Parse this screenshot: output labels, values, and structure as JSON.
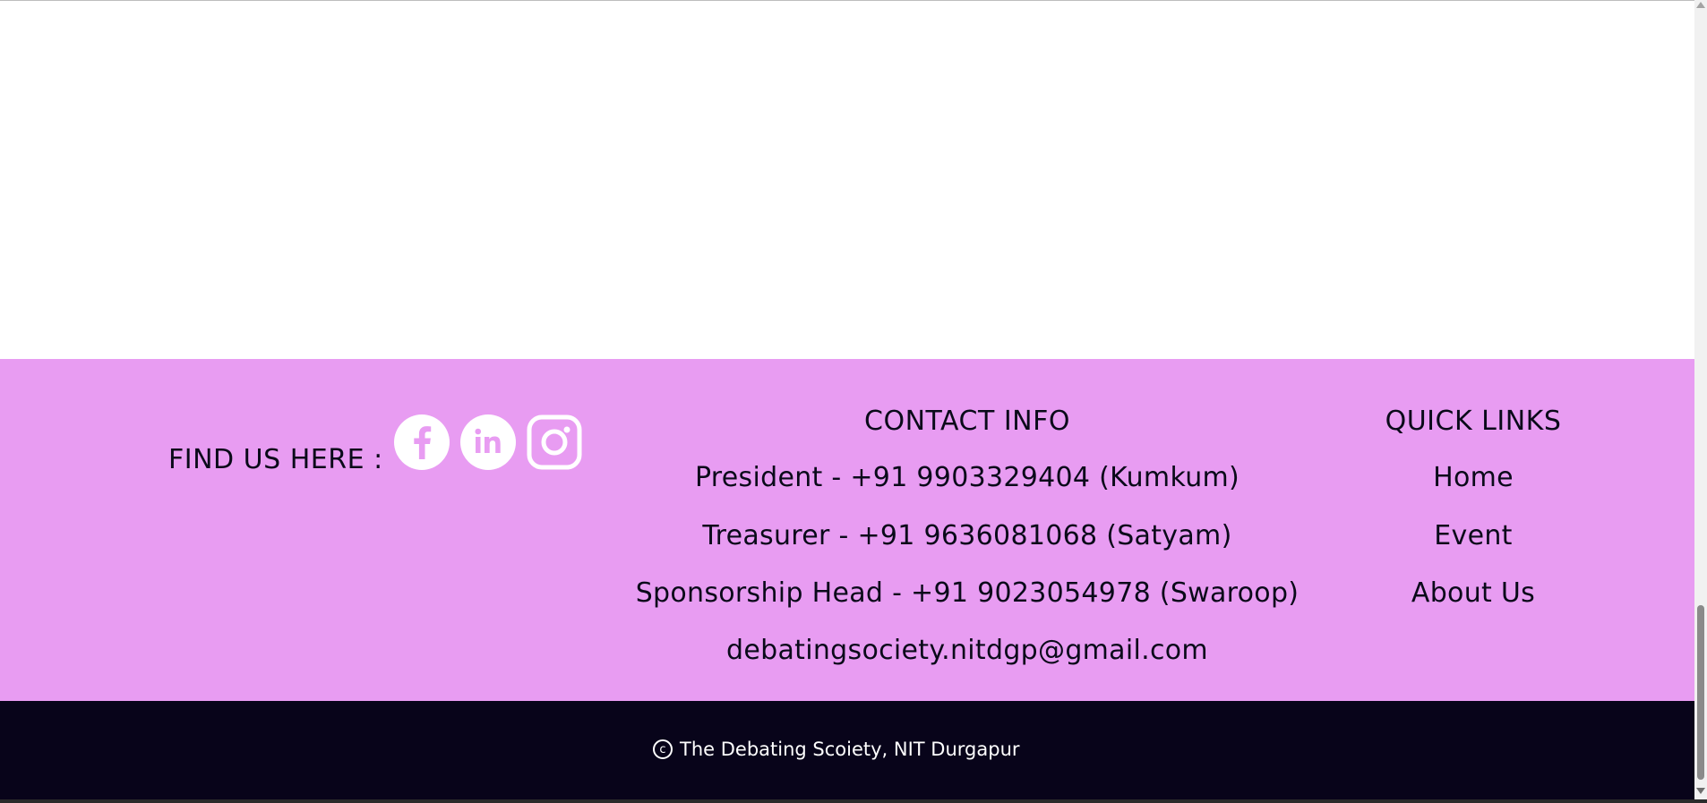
{
  "footer": {
    "find_us_label": "FIND US HERE :",
    "social": [
      {
        "name": "facebook-icon",
        "glyph": "f"
      },
      {
        "name": "linkedin-icon",
        "glyph": "in"
      },
      {
        "name": "instagram-icon",
        "glyph": ""
      }
    ],
    "contact": {
      "heading": "CONTACT INFO",
      "lines": [
        "President - +91 9903329404 (Kumkum)",
        "Treasurer - +91 9636081068 (Satyam)",
        "Sponsorship Head - +91 9023054978 (Swaroop)",
        "debatingsociety.nitdgp@gmail.com"
      ]
    },
    "quick_links": {
      "heading": "QUICK LINKS",
      "items": [
        "Home",
        "Event",
        "About Us"
      ]
    },
    "background_color": "#e89cf2"
  },
  "bottom_bar": {
    "copyright_symbol": "c",
    "copyright_text": "The Debating Scoiety, NIT Durgapur",
    "background_color": "#08041a"
  }
}
